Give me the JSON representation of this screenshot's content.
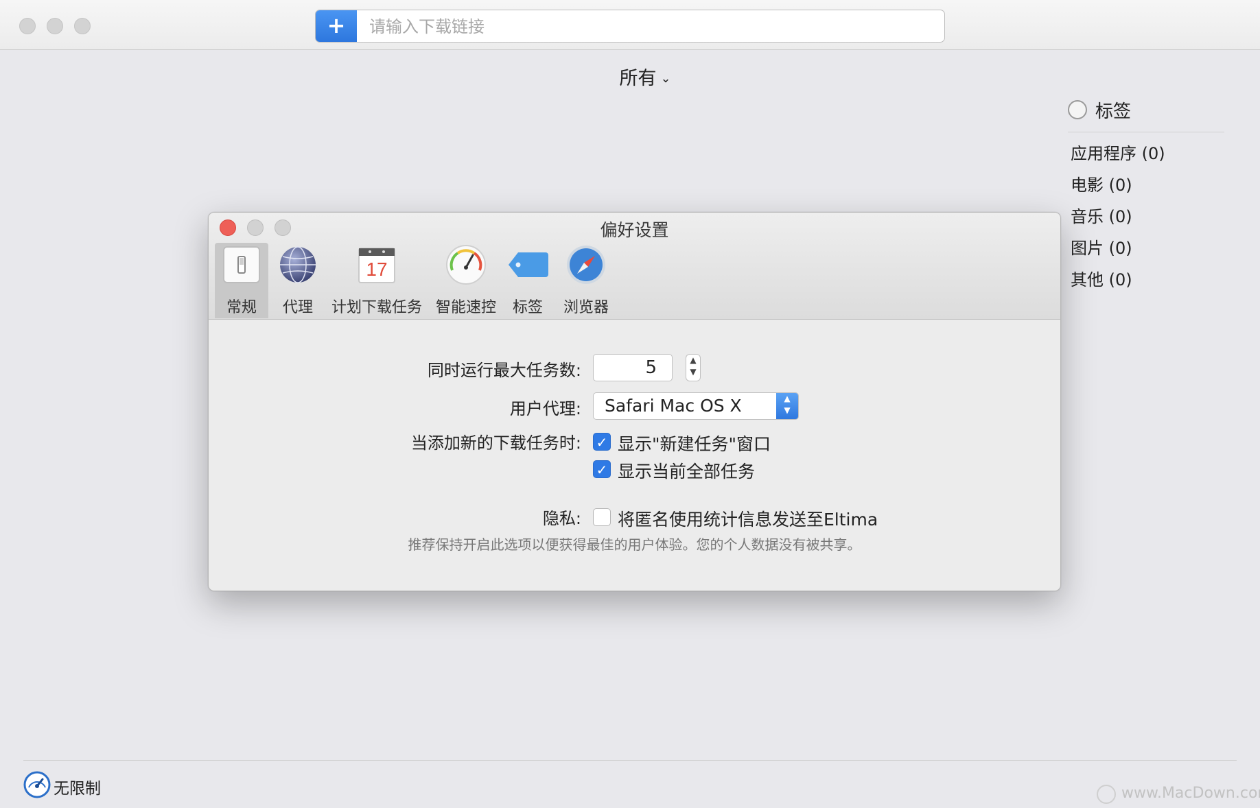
{
  "window": {
    "url_placeholder": "请输入下载链接",
    "filter_label": "所有",
    "add_icon": "plus-icon"
  },
  "tags": {
    "title": "标签",
    "items": [
      "应用程序 (0)",
      "电影 (0)",
      "音乐 (0)",
      "图片 (0)",
      "其他 (0)"
    ]
  },
  "status": {
    "speed_label": "无限制",
    "watermark": "www.MacDown.com"
  },
  "preferences": {
    "title": "偏好设置",
    "tabs": [
      {
        "label": "常规",
        "icon": "switch-icon"
      },
      {
        "label": "代理",
        "icon": "globe-icon"
      },
      {
        "label": "计划下载任务",
        "icon": "calendar-icon"
      },
      {
        "label": "智能速控",
        "icon": "speedometer-icon"
      },
      {
        "label": "标签",
        "icon": "tag-icon"
      },
      {
        "label": "浏览器",
        "icon": "compass-icon"
      }
    ],
    "calendar_day": "17",
    "max_tasks_label": "同时运行最大任务数:",
    "max_tasks_value": "5",
    "user_agent_label": "用户代理:",
    "user_agent_value": "Safari Mac OS X",
    "on_add_label": "当添加新的下载任务时:",
    "show_new_task_window": "显示\"新建任务\"窗口",
    "show_all_tasks": "显示当前全部任务",
    "privacy_label": "隐私:",
    "privacy_option": "将匿名使用统计信息发送至Eltima",
    "privacy_hint": "推荐保持开启此选项以便获得最佳的用户体验。您的个人数据没有被共享。"
  },
  "colors": {
    "accent": "#2f7ae5",
    "close": "#ee5f57"
  }
}
